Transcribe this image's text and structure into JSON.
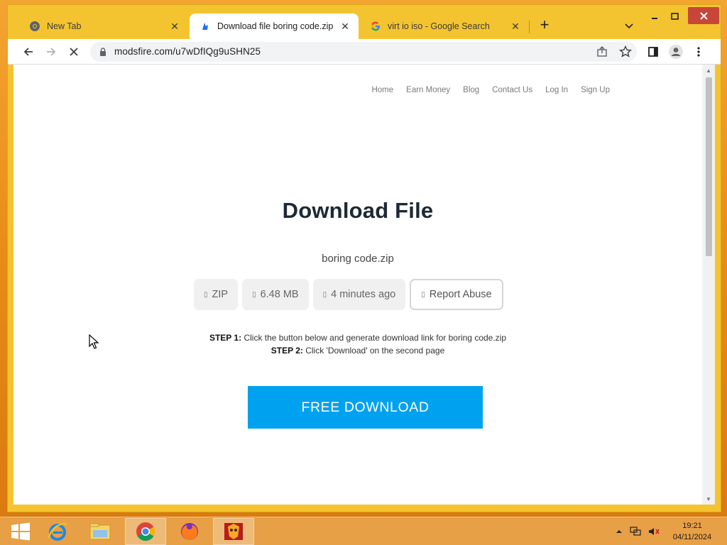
{
  "browser": {
    "tabs": [
      {
        "title": "New Tab",
        "favicon": "chrome-icon",
        "active": false
      },
      {
        "title": "Download file boring code.zip - M",
        "favicon": "modsfire-icon",
        "active": true
      },
      {
        "title": "virt io iso - Google Search",
        "favicon": "google-icon",
        "active": false
      }
    ],
    "tab_close_glyph": "✕",
    "new_tab_glyph": "+",
    "url": "modsfire.com/u7wDfIQg9uSHN25"
  },
  "site": {
    "nav": [
      "Home",
      "Earn Money",
      "Blog",
      "Contact Us",
      "Log In",
      "Sign Up"
    ],
    "page_title": "Download File",
    "file_name": "boring code.zip",
    "chips": {
      "type": "ZIP",
      "size": "6.48 MB",
      "uploaded": "4 minutes ago",
      "report": "Report Abuse"
    },
    "step1_label": "STEP 1:",
    "step1_text": " Click the button below and generate download link for boring code.zip",
    "step2_label": "STEP 2:",
    "step2_text": " Click 'Download' on the second page",
    "download_button": "FREE DOWNLOAD",
    "colors": {
      "accent": "#00a2ef",
      "title": "#1e2936"
    }
  },
  "taskbar": {
    "time": "19:21",
    "date": "04/11/2024",
    "apps": [
      "internet-explorer-icon",
      "file-explorer-icon",
      "chrome-icon",
      "firefox-icon",
      "game-app-icon"
    ]
  }
}
